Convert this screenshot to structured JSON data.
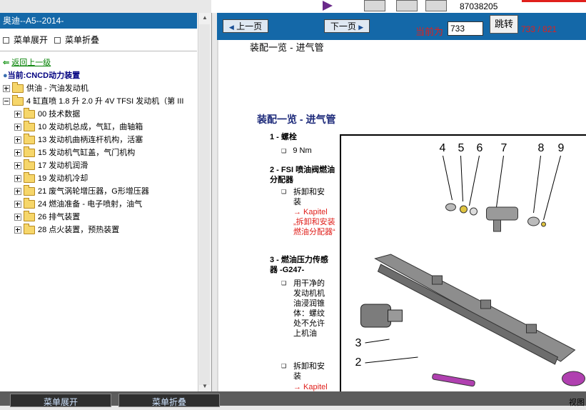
{
  "top": {
    "doc_number": "87038205"
  },
  "left_panel": {
    "title": "奥迪--A5--2014-",
    "expand_label": "菜单展开",
    "collapse_label": "菜单折叠",
    "back_label": "返回上一级",
    "current_label": "当前:CNCD动力装置",
    "tree": [
      {
        "label": "供油 - 汽油发动机",
        "level": 0,
        "expanded": false
      },
      {
        "label": "4 缸直喷 1.8 升 2.0 升 4V TFSI 发动机（第 III",
        "level": 0,
        "expanded": true
      },
      {
        "label": "00 技术数据",
        "level": 1,
        "expanded": false
      },
      {
        "label": "10 发动机总成，气缸，曲轴箱",
        "level": 1,
        "expanded": false
      },
      {
        "label": "13 发动机曲柄连杆机构，活塞",
        "level": 1,
        "expanded": false
      },
      {
        "label": "15 发动机气缸盖，气门机构",
        "level": 1,
        "expanded": false
      },
      {
        "label": "17 发动机润滑",
        "level": 1,
        "expanded": false
      },
      {
        "label": "19 发动机冷却",
        "level": 1,
        "expanded": false
      },
      {
        "label": "21 废气涡轮增压器，G形增压器",
        "level": 1,
        "expanded": false
      },
      {
        "label": "24 燃油准备 - 电子喷射，油气",
        "level": 1,
        "expanded": false
      },
      {
        "label": "26 排气装置",
        "level": 1,
        "expanded": false
      },
      {
        "label": "28 点火装置，预热装置",
        "level": 1,
        "expanded": false
      }
    ]
  },
  "nav": {
    "prev_label": "上一页",
    "next_label": "下一页",
    "current_page_label": "当前为",
    "page_input_value": "733",
    "jump_label": "跳转",
    "page_count": "733 / 821"
  },
  "doc": {
    "header": "装配一览 - 进气管",
    "section_title": "装配一览 - 进气管",
    "items": [
      {
        "num": "1 -",
        "title": "螺栓",
        "bullets": [
          "9 Nm"
        ]
      },
      {
        "num": "2 -",
        "title": "FSI 喷油阀燃油分配器",
        "bullets": [
          "拆卸和安装"
        ],
        "link_arrow": "→ Kapitel",
        "link_text": "„拆卸和安装燃油分配器“"
      },
      {
        "num": "3 -",
        "title": "燃油压力传感器 -G247-",
        "bullets": [
          "用干净的发动机机油浸润锥体：螺纹处不允许上机油",
          "拆卸和安装"
        ],
        "link_arrow": "→ Kapitel"
      }
    ],
    "callouts": [
      "4",
      "5",
      "6",
      "7",
      "8",
      "9",
      "3",
      "2"
    ]
  },
  "bottom": {
    "left_btn": "菜单展开",
    "mid_btn": "菜单折叠",
    "right_text": "视图"
  },
  "colors": {
    "title_bar": "#1468a8",
    "accent_red": "#e0201c",
    "section_title": "#1d2a7a",
    "back_link": "#008000"
  }
}
